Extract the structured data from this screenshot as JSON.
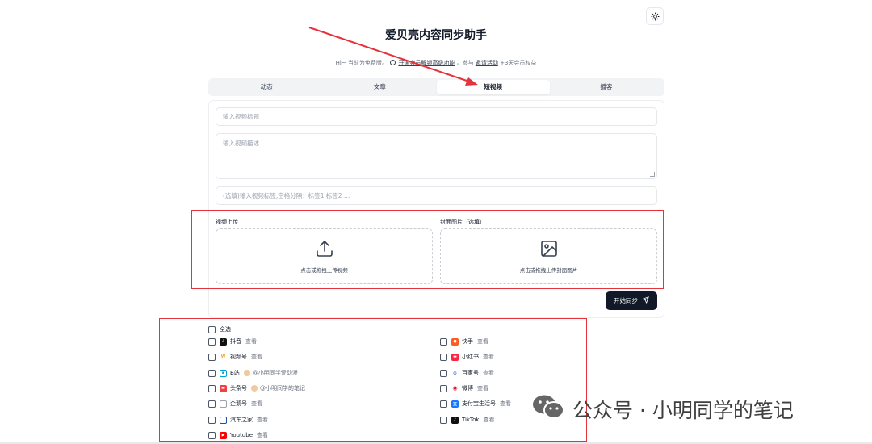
{
  "header": {
    "title": "爱贝壳内容同步助手",
    "subtitle_prefix": "Hi~ 当前为免费版。",
    "subtitle_link1": "开通会员解锁高级功能",
    "subtitle_mid": "。参与",
    "subtitle_link2": "邀请活动",
    "subtitle_suffix": "+3天会员权益"
  },
  "tabs": [
    {
      "label": "动态",
      "active": false
    },
    {
      "label": "文章",
      "active": false
    },
    {
      "label": "短视频",
      "active": true
    },
    {
      "label": "播客",
      "active": false
    }
  ],
  "form": {
    "title_placeholder": "输入视频标题",
    "desc_placeholder": "输入视频描述",
    "tags_placeholder": "(选填)输入视频标签,空格分隔：标签1 标签2 ..."
  },
  "upload": {
    "video_label": "视频上传",
    "video_hint": "点击或拖拽上传视频",
    "cover_label": "封面图片（选填）",
    "cover_hint": "点击或拖拽上传封面图片"
  },
  "sync_button": "开始同步",
  "select_all": "全选",
  "view_label": "查看",
  "platforms": {
    "douyin": {
      "name": "抖音",
      "color": "#111111"
    },
    "kuaishou": {
      "name": "快手",
      "color": "#ff5a1f"
    },
    "shipinhao": {
      "name": "视频号",
      "color": "#f5a623"
    },
    "xiaohongshu": {
      "name": "小红书",
      "color": "#ff2442"
    },
    "bilibili": {
      "name": "B站",
      "account": "@小明同学爱动漫",
      "color": "#00a1d6"
    },
    "baijiahao": {
      "name": "百家号",
      "color": "#2b5cde"
    },
    "toutiao": {
      "name": "头条号",
      "account": "@小明同学的笔记",
      "color": "#f04142"
    },
    "weibo": {
      "name": "微博",
      "color": "#e6162d"
    },
    "qiehao": {
      "name": "企鹅号",
      "color": "#9ca3af"
    },
    "alipay": {
      "name": "支付宝生活号",
      "color": "#1677ff"
    },
    "autohome": {
      "name": "汽车之家",
      "color": "#1b4ea8"
    },
    "tiktok": {
      "name": "TikTok",
      "color": "#111111"
    },
    "youtube": {
      "name": "Youtube",
      "color": "#ff0000"
    }
  },
  "watermark": "公众号 · 小明同学的笔记",
  "colors": {
    "accent": "#111827",
    "annotation": "#e5333b",
    "tab_bg": "#f1f3f5"
  }
}
